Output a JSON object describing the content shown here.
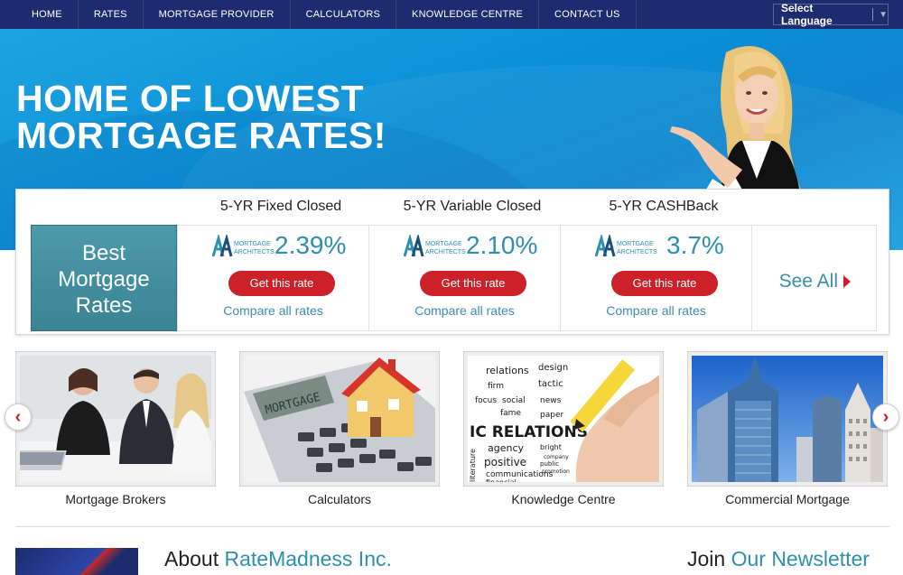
{
  "nav": {
    "items": [
      "HOME",
      "RATES",
      "MORTGAGE PROVIDER",
      "CALCULATORS",
      "KNOWLEDGE CENTRE",
      "CONTACT US"
    ],
    "language_label": "Select Language"
  },
  "hero": {
    "headline_line1": "HOME OF LOWEST",
    "headline_line2": "MORTGAGE RATES!"
  },
  "rates": {
    "best_line1": "Best",
    "best_line2": "Mortgage",
    "best_line3": "Rates",
    "cards": [
      {
        "heading": "5-YR Fixed Closed",
        "logo_line1": "MORTGAGE",
        "logo_line2": "ARCHITECTS",
        "rate": "2.39%",
        "button": "Get this rate",
        "compare": "Compare all rates"
      },
      {
        "heading": "5-YR Variable Closed",
        "logo_line1": "MORTGAGE",
        "logo_line2": "ARCHITECTS",
        "rate": "2.10%",
        "button": "Get this rate",
        "compare": "Compare all rates"
      },
      {
        "heading": "5-YR CASHBack",
        "logo_line1": "MORTGAGE",
        "logo_line2": "ARCHITECTS",
        "rate": "3.7%",
        "button": "Get this rate",
        "compare": "Compare all rates"
      }
    ],
    "see_all": "See All"
  },
  "tiles": [
    {
      "label": "Mortgage Brokers"
    },
    {
      "label": "Calculators"
    },
    {
      "label": "Knowledge Centre"
    },
    {
      "label": "Commercial Mortgage"
    }
  ],
  "calculator_display": "MORTGAGE",
  "knowledge_words": [
    "relations",
    "design",
    "firm",
    "tactic",
    "focus",
    "social",
    "fame",
    "news",
    "paper",
    "IC RELATIONS",
    "agency",
    "bright",
    "positive",
    "communications",
    "financial",
    "public",
    "promotion",
    "company",
    "literature"
  ],
  "about": {
    "prefix": "About ",
    "highlight": "RateMadness Inc."
  },
  "newsletter": {
    "prefix": "Join ",
    "highlight": "Our Newsletter"
  },
  "colors": {
    "nav_bg": "#1d2c6e",
    "hero_blue": "#0a8fd6",
    "accent_red": "#cc2129",
    "link_blue": "#2e8fb0",
    "best_teal": "#4d9aaa"
  }
}
